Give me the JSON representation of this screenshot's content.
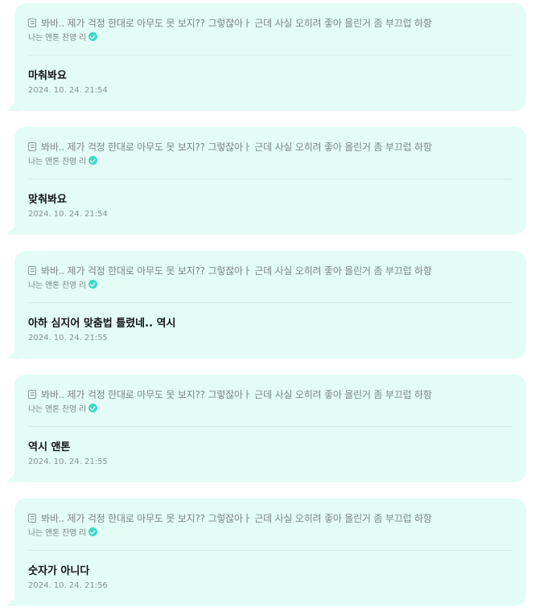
{
  "replies": [
    {
      "quote": "봐바.. 제가 걱정 한대로 아무도 못 보지?? 그렇잖아ㅏ 근데 사실 오히려 좋아 올린거 좀 부끄럽 하항",
      "author": "나는 앤톤 찬영 리",
      "message": "마춰봐요",
      "timestamp": "2024. 10. 24. 21:54"
    },
    {
      "quote": "봐바.. 제가 걱정 한대로 아무도 못 보지?? 그렇잖아ㅏ 근데 사실 오히려 좋아 올린거 좀 부끄럽 하항",
      "author": "나는 앤톤 찬영 리",
      "message": "맞춰봐요",
      "timestamp": "2024. 10. 24. 21:54"
    },
    {
      "quote": "봐바.. 제가 걱정 한대로 아무도 못 보지?? 그렇잖아ㅏ 근데 사실 오히려 좋아 올린거 좀 부끄럽 하항",
      "author": "나는 앤톤 찬영 리",
      "message": "아하 심지어 맞춤법 틀렸네.. 역시",
      "timestamp": "2024. 10. 24. 21:55"
    },
    {
      "quote": "봐바.. 제가 걱정 한대로 아무도 못 보지?? 그렇잖아ㅏ 근데 사실 오히려 좋아 올린거 좀 부끄럽 하항",
      "author": "나는 앤톤 찬영 리",
      "message": "역시 앤톤",
      "timestamp": "2024. 10. 24. 21:55"
    },
    {
      "quote": "봐바.. 제가 걱정 한대로 아무도 못 보지?? 그렇잖아ㅏ 근데 사실 오히려 좋아 올린거 좀 부끄럽 하항",
      "author": "나는 앤톤 찬영 리",
      "message": "숫자가 아니다",
      "timestamp": "2024. 10. 24. 21:56"
    }
  ],
  "colors": {
    "bubble_background": "#e3fcf6",
    "verified_badge": "#3fd8c6",
    "secondary_text": "#7d8581",
    "message_text": "#141414"
  },
  "icons": {
    "quote": "document-icon",
    "author_badge": "verified-check-icon"
  }
}
